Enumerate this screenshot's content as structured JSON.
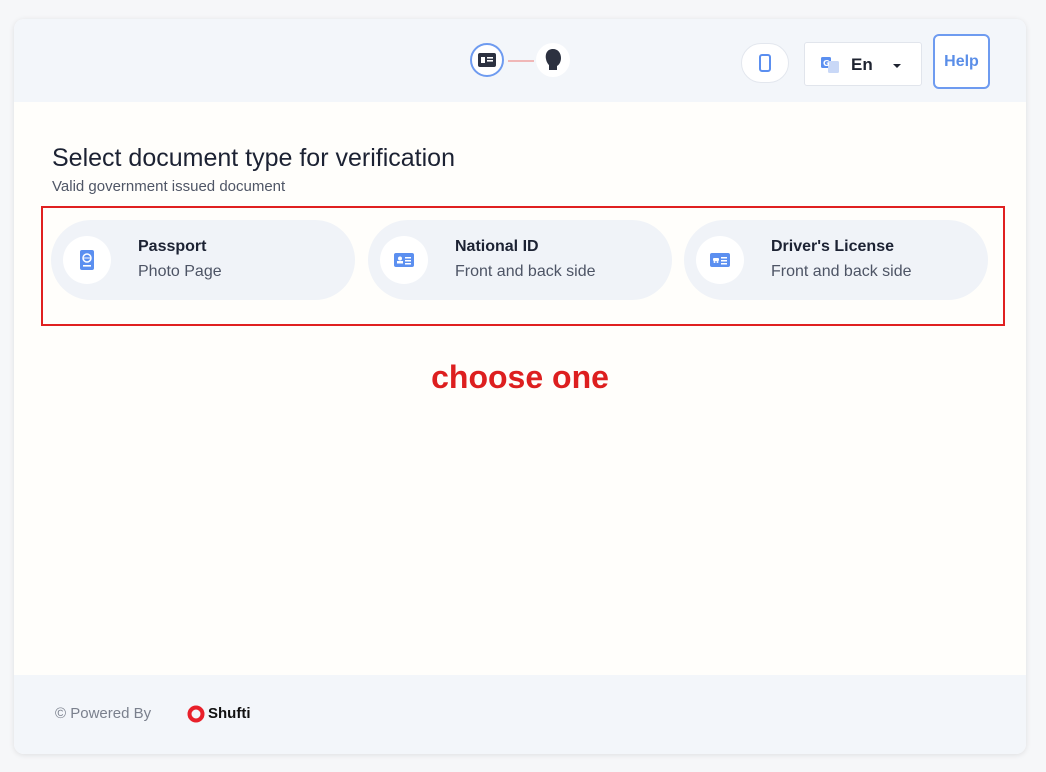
{
  "header": {
    "steps": [
      {
        "icon": "id-card-icon",
        "state": "active"
      },
      {
        "icon": "face-icon",
        "state": "pending"
      }
    ],
    "mobile_icon": "mobile-phone-icon",
    "language": {
      "icon": "translate-icon",
      "label": "En"
    },
    "help_label": "Help"
  },
  "main": {
    "title": "Select document type for verification",
    "subtitle": "Valid government issued document",
    "options": [
      {
        "icon": "passport-icon",
        "label": "Passport",
        "description": "Photo Page"
      },
      {
        "icon": "national-id-icon",
        "label": "National ID",
        "description": "Front and back side"
      },
      {
        "icon": "drivers-license-icon",
        "label": "Driver's License",
        "description": "Front and back side"
      }
    ],
    "annotation": "choose one"
  },
  "footer": {
    "powered_by": "© Powered By",
    "brand": "Shufti"
  },
  "colors": {
    "accent": "#6e9bf0",
    "icon_blue": "#5b8ff0",
    "annotation_red": "#e02020",
    "brand_red": "#e8202a"
  }
}
